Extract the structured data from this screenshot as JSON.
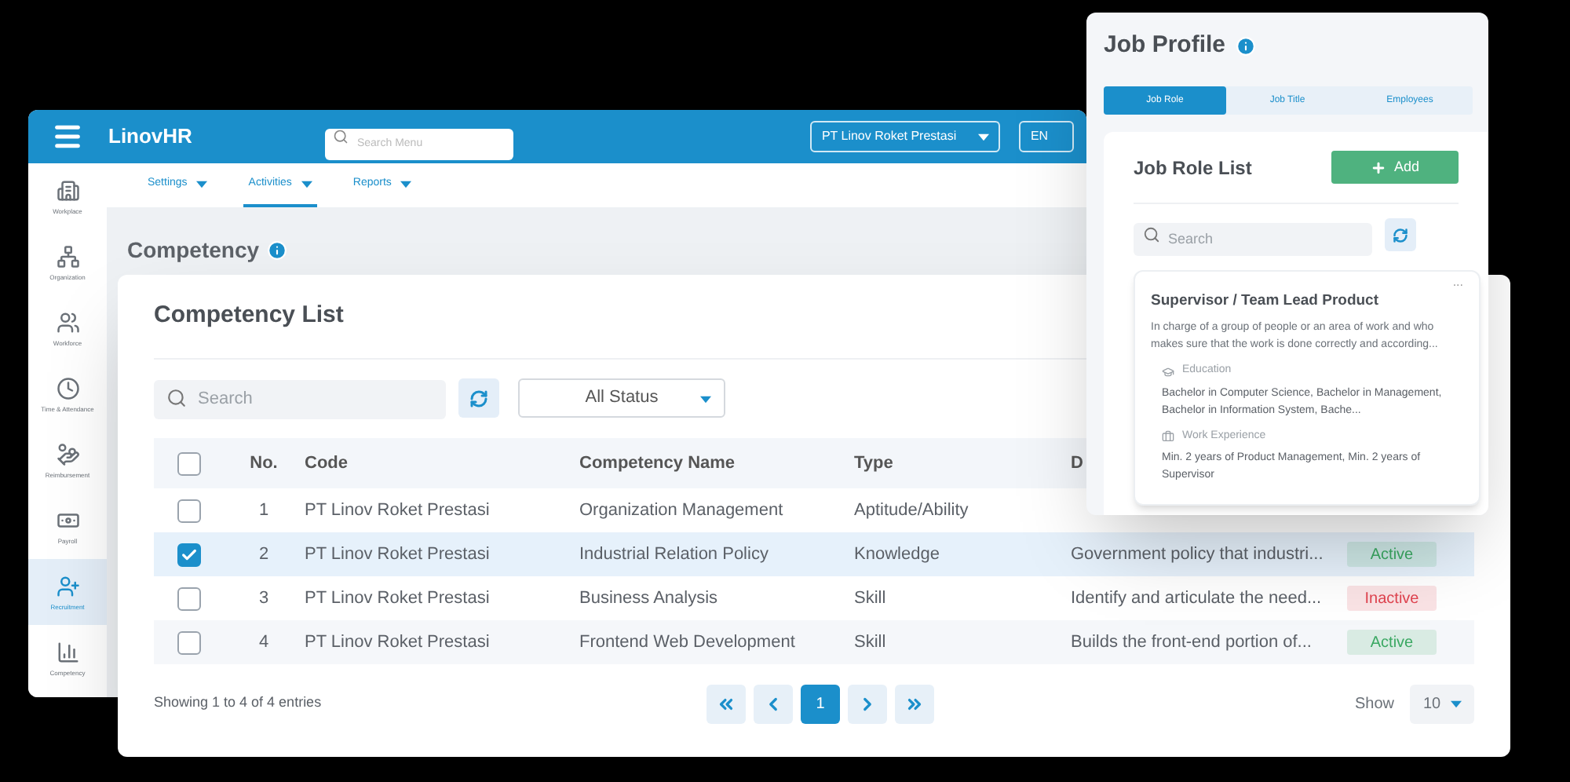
{
  "app": {
    "brand": "LinovHR",
    "search_placeholder": "Search Menu",
    "company": "PT Linov Roket Prestasi",
    "language": "EN"
  },
  "sidebar": [
    {
      "label": "Workplace",
      "selected": false
    },
    {
      "label": "Organization",
      "selected": false
    },
    {
      "label": "Workforce",
      "selected": false
    },
    {
      "label": "Time & Attendance",
      "selected": false
    },
    {
      "label": "Reimbursement",
      "selected": false
    },
    {
      "label": "Payroll",
      "selected": false
    },
    {
      "label": "Recruitment",
      "selected": true
    },
    {
      "label": "Competency",
      "selected": false
    }
  ],
  "nav_tabs": [
    {
      "label": "Settings",
      "selected": false
    },
    {
      "label": "Activities",
      "selected": true
    },
    {
      "label": "Reports",
      "selected": false
    }
  ],
  "page_title": "Competency",
  "competency_list": {
    "title": "Competency List",
    "search_placeholder": "Search",
    "status_filter": "All Status",
    "select_all_checked": false,
    "columns": [
      "No.",
      "Code",
      "Competency Name",
      "Type",
      "D"
    ],
    "rows": [
      {
        "checked": false,
        "no": "1",
        "code": "PT Linov Roket Prestasi",
        "name": "Organization Management",
        "type": "Aptitude/Ability"
      },
      {
        "checked": true,
        "no": "2",
        "code": "PT Linov Roket Prestasi",
        "name": "Industrial Relation Policy",
        "type": "Knowledge",
        "description": "Government policy that industri...",
        "status": "Active",
        "color": "#3aa862"
      },
      {
        "checked": false,
        "no": "3",
        "code": "PT Linov Roket Prestasi",
        "name": "Business Analysis",
        "type": "Skill",
        "description": "Identify and articulate the need...",
        "status": "Inactive",
        "color": "#e0434f"
      },
      {
        "checked": false,
        "no": "4",
        "code": "PT Linov Roket Prestasi",
        "name": "Frontend Web Development",
        "type": "Skill",
        "description": "Builds the front-end portion of...",
        "status": "Active",
        "color": "#3aa862"
      }
    ],
    "footer": "Showing 1 to 4 of 4 entries",
    "pages": [
      {
        "label": "1",
        "selected": true
      }
    ],
    "show_label": "Show",
    "page_size": "10"
  },
  "job_profile": {
    "title": "Job Profile",
    "tabs": [
      {
        "label": "Job Role",
        "selected": true
      },
      {
        "label": "Job Title",
        "selected": false
      },
      {
        "label": "Employees",
        "selected": false
      }
    ],
    "list_title": "Job Role List",
    "add_label": "Add",
    "search_placeholder": "Search",
    "more": "...",
    "role": {
      "title": "Supervisor / Team Lead Product",
      "description": "In charge of a group of people or an area of work and who makes sure that the work is done correctly and according...",
      "sections": [
        {
          "heading": "Education",
          "text": "Bachelor in Computer Science, Bachelor in Management, Bachelor in Information System, Bache..."
        },
        {
          "heading": "Work Experience",
          "text": "Min. 2 years of Product Management, Min. 2 years of Supervisor"
        }
      ]
    }
  }
}
